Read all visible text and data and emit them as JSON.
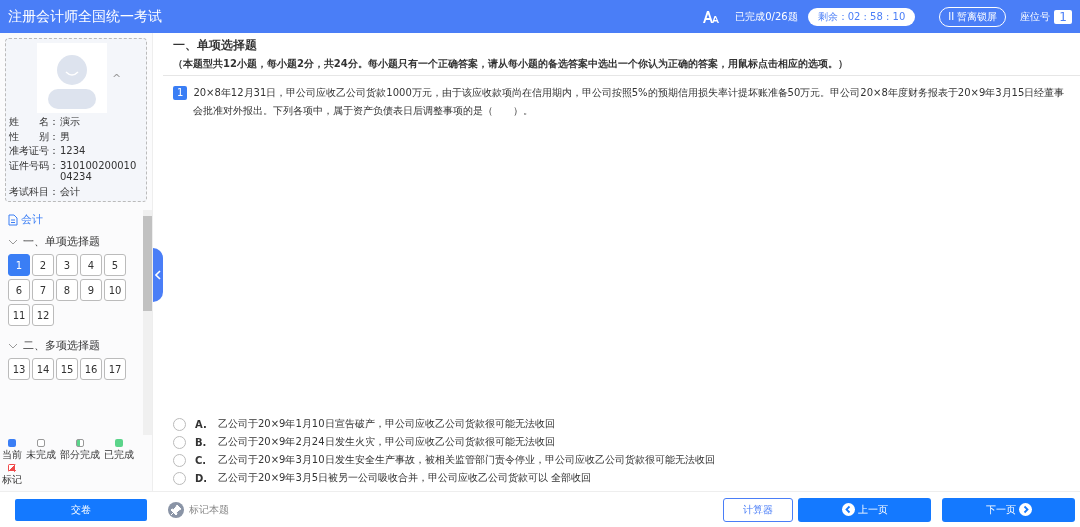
{
  "header": {
    "title": "注册会计师全国统一考试",
    "progress": "已完成0/26题",
    "timer": "剩余：02 : 58 : 10",
    "pause_button": "II 暂离锁屏",
    "seat_label": "座位号",
    "seat_number": "1"
  },
  "profile": {
    "caret": "^",
    "fields": [
      {
        "label": "姓　　名：",
        "value": "演示"
      },
      {
        "label": "性　　别：",
        "value": "男"
      },
      {
        "label": "准考证号：",
        "value": "1234"
      },
      {
        "label": "证件号码：",
        "value": "310100200010 04234"
      },
      {
        "label": "考试科目：",
        "value": "会计"
      }
    ]
  },
  "navigator": {
    "subject": "会计",
    "sections": [
      {
        "title": "一、单项选择题",
        "expanded": true,
        "questions": [
          {
            "number": "1",
            "selected": true
          },
          {
            "number": "2",
            "selected": false
          },
          {
            "number": "3",
            "selected": false
          },
          {
            "number": "4",
            "selected": false
          },
          {
            "number": "5",
            "selected": false
          },
          {
            "number": "6",
            "selected": false
          },
          {
            "number": "7",
            "selected": false
          },
          {
            "number": "8",
            "selected": false
          },
          {
            "number": "9",
            "selected": false
          },
          {
            "number": "10",
            "selected": false
          },
          {
            "number": "11",
            "selected": false
          },
          {
            "number": "12",
            "selected": false
          }
        ]
      },
      {
        "title": "二、多项选择题",
        "expanded": true,
        "questions": [
          {
            "number": "13",
            "selected": false
          },
          {
            "number": "14",
            "selected": false
          },
          {
            "number": "15",
            "selected": false
          },
          {
            "number": "16",
            "selected": false
          },
          {
            "number": "17",
            "selected": false
          }
        ]
      }
    ]
  },
  "legend": [
    {
      "kind": "current",
      "label": "当前"
    },
    {
      "kind": "undone",
      "label": "未完成"
    },
    {
      "kind": "partial",
      "label": "部分完成"
    },
    {
      "kind": "done",
      "label": "已完成"
    },
    {
      "kind": "marked",
      "label": "标记"
    }
  ],
  "section": {
    "title": "一、单项选择题",
    "instructions": "（本题型共12小题，每小题2分，共24分。每小题只有一个正确答案，请从每小题的备选答案中选出一个你认为正确的答案，用鼠标点击相应的选项。）"
  },
  "question": {
    "number": "1",
    "text": "20×8年12月31日，甲公司应收乙公司货款1000万元，由于该应收款项尚在信用期内，甲公司按照5%的预期信用损失率计提坏账准备50万元。甲公司20×8年度财务报表于20×9年3月15日经董事会批准对外报出。下列各项中，属于资产负债表日后调整事项的是（　　）。",
    "options": [
      {
        "letter": "A.",
        "text": "乙公司于20×9年1月10日宣告破产，甲公司应收乙公司货款很可能无法收回",
        "selected": false
      },
      {
        "letter": "B.",
        "text": "乙公司于20×9年2月24日发生火灾，甲公司应收乙公司货款很可能无法收回",
        "selected": false
      },
      {
        "letter": "C.",
        "text": "乙公司于20×9年3月10日发生安全生产事故，被相关监管部门责令停业，甲公司应收乙公司货款很可能无法收回",
        "selected": false
      },
      {
        "letter": "D.",
        "text": "乙公司于20×9年3月5日被另一公司吸收合并，甲公司应收乙公司货款可以 全部收回",
        "selected": false
      }
    ]
  },
  "footer": {
    "submit": "交卷",
    "mark": "标记本题",
    "calculator": "计算器",
    "prev": "上一页",
    "next": "下一页"
  }
}
